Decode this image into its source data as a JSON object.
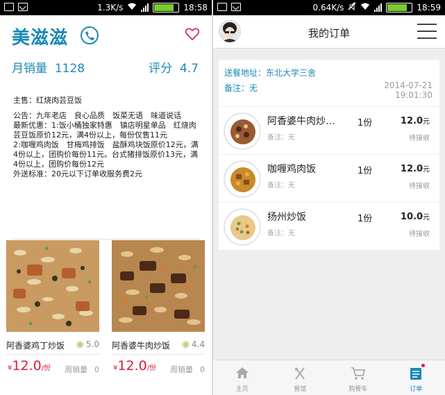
{
  "left": {
    "status": {
      "speed": "1.3K/s",
      "time": "18:58",
      "battery": ""
    },
    "shop_name": "美滋滋",
    "sales_label": "月销量",
    "sales_value": "1128",
    "rating_label": "评分",
    "rating_value": "4.7",
    "main_item": "主售：红烧肉芸豆饭",
    "notice": "公告：九年老店　良心品质　饭菜无语　味道说话\n最新优惠：1:饭小桶独家特惠　镇店明星单品　红烧肉芸豆饭原价12元，满4份以上，每份仅售11元\n2:咖喱鸡肉饭　甘梅鸡排饭　盐酥鸡块饭原价12元，满4份以上，团购价每份11元。台式猪排饭原价13元，满4份以上，团购价每份12元\n外送标准：20元以下订单收服务费2元",
    "cards": [
      {
        "name": "阿香婆鸡丁炒饭",
        "score": "5.0",
        "yen": "¥",
        "price": "12.0",
        "unit": "/份",
        "sold_label": "周销量",
        "sold": "0"
      },
      {
        "name": "阿香婆牛肉炒饭",
        "score": "4.4",
        "yen": "¥",
        "price": "12.0",
        "unit": "/份",
        "sold_label": "周销量",
        "sold": "0"
      }
    ]
  },
  "right": {
    "status": {
      "speed": "0.64K/s",
      "time": "18:59"
    },
    "title": "我的订单",
    "address": "送餐地址：东北大学三舍",
    "remark": "备注：无",
    "date": "2014-07-21",
    "time": "19:01:30",
    "items": [
      {
        "name": "阿香婆牛肉炒…",
        "note": "备注：无",
        "qty": "1份",
        "price": "12.0",
        "unit": "元",
        "state": "待接收"
      },
      {
        "name": "咖喱鸡肉饭",
        "note": "备注：无",
        "qty": "1份",
        "price": "12.0",
        "unit": "元",
        "state": "待接收"
      },
      {
        "name": "扬州炒饭",
        "note": "备注：无",
        "qty": "1份",
        "price": "10.0",
        "unit": "元",
        "state": "待接收"
      }
    ],
    "tabs": [
      {
        "label": "主页",
        "icon": "home-icon"
      },
      {
        "label": "餐馆",
        "icon": "restaurant-icon"
      },
      {
        "label": "购餐车",
        "icon": "cart-icon"
      },
      {
        "label": "订单",
        "icon": "orders-icon"
      }
    ]
  },
  "colors": {
    "accent": "#1a8ab6",
    "price": "#d81b3c",
    "battery": "#7acc2c"
  }
}
